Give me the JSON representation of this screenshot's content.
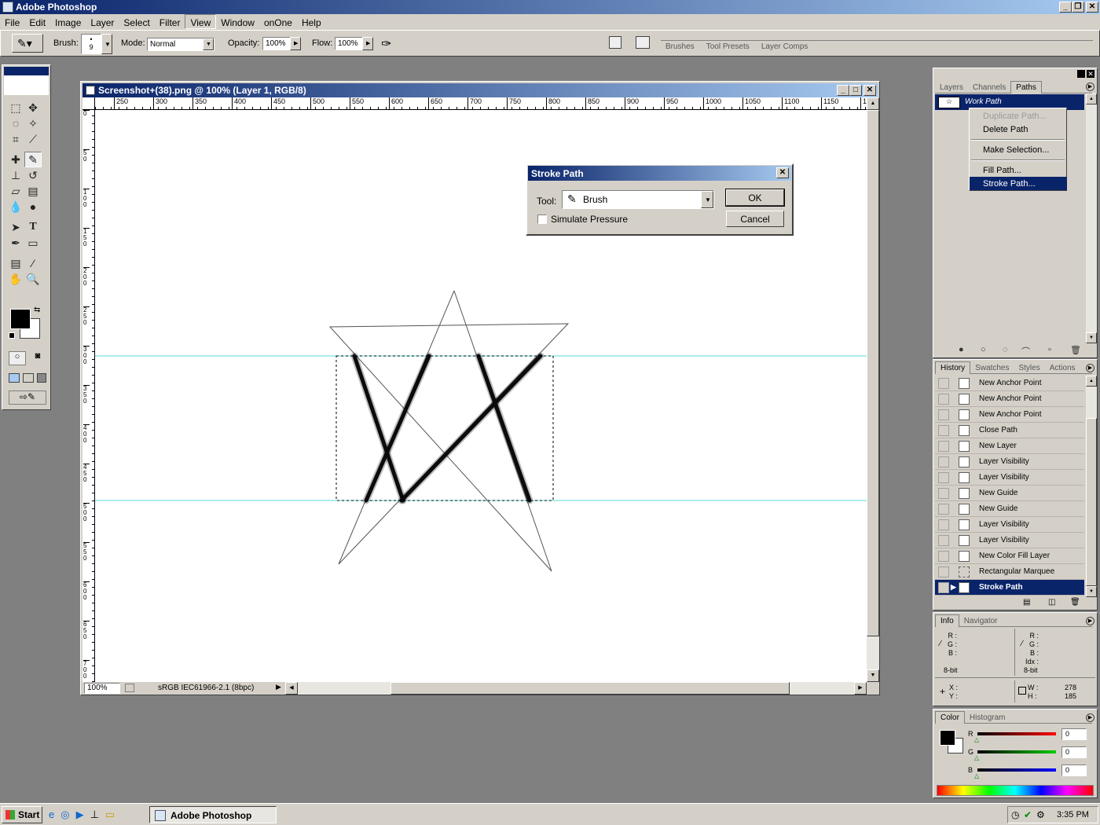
{
  "app": {
    "title": "Adobe Photoshop"
  },
  "menu": [
    "File",
    "Edit",
    "Image",
    "Layer",
    "Select",
    "Filter",
    "View",
    "Window",
    "onOne",
    "Help"
  ],
  "options": {
    "brush_label": "Brush:",
    "brush_size": "9",
    "mode_label": "Mode:",
    "mode_value": "Normal",
    "opacity_label": "Opacity:",
    "opacity_value": "100%",
    "flow_label": "Flow:",
    "flow_value": "100%",
    "well_tabs": [
      "Brushes",
      "Tool Presets",
      "Layer Comps"
    ]
  },
  "document": {
    "title": "Screenshot+(38).png @ 100% (Layer 1, RGB/8)",
    "zoom": "100%",
    "profile": "sRGB IEC61966-2.1 (8bpc)",
    "ruler_h": [
      "250",
      "300",
      "350",
      "400",
      "450",
      "500",
      "550",
      "600",
      "650",
      "700",
      "750",
      "800",
      "850",
      "900",
      "950",
      "1000",
      "1050",
      "1100",
      "1150",
      "12"
    ],
    "ruler_v": [
      "0",
      "5 0",
      "1 0 0",
      "1 5 0",
      "2 0 0",
      "2 5 0",
      "3 0 0",
      "3 5 0",
      "4 0 0",
      "4 5 0",
      "5 0 0",
      "5 5 0",
      "6 0 0",
      "6 5 0",
      "7 0 0"
    ]
  },
  "dialog": {
    "title": "Stroke Path",
    "tool_label": "Tool:",
    "tool_value": "Brush",
    "simulate_label": "Simulate Pressure",
    "simulate_checked": false,
    "ok": "OK",
    "cancel": "Cancel"
  },
  "paths_panel": {
    "tabs": [
      "Layers",
      "Channels",
      "Paths"
    ],
    "work_path": "Work Path",
    "context_menu": [
      {
        "label": "Duplicate Path...",
        "disabled": true
      },
      {
        "label": "Delete Path",
        "disabled": false
      },
      {
        "label": "Make Selection...",
        "disabled": false
      },
      {
        "label": "Fill Path...",
        "disabled": false
      },
      {
        "label": "Stroke Path...",
        "disabled": false,
        "selected": true
      }
    ]
  },
  "history_panel": {
    "tabs": [
      "History",
      "Swatches",
      "Styles",
      "Actions"
    ],
    "items": [
      "New Anchor Point",
      "New Anchor Point",
      "New Anchor Point",
      "Close Path",
      "New Layer",
      "Layer Visibility",
      "Layer Visibility",
      "New Guide",
      "New Guide",
      "Layer Visibility",
      "Layer Visibility",
      "New Color Fill Layer",
      "Rectangular Marquee",
      "Stroke Path"
    ]
  },
  "info_panel": {
    "tabs": [
      "Info",
      "Navigator"
    ],
    "left": {
      "r": "R :",
      "g": "G :",
      "b": "B :",
      "bit": "8-bit"
    },
    "right": {
      "r": "R :",
      "g": "G :",
      "b": "B :",
      "idx": "Idx :",
      "bit": "8-bit"
    },
    "xy": {
      "x": "X :",
      "y": "Y :"
    },
    "wh": {
      "w": "W :",
      "h": "H :",
      "w_val": "278",
      "h_val": "185"
    }
  },
  "color_panel": {
    "tabs": [
      "Color",
      "Histogram"
    ],
    "r_label": "R",
    "g_label": "G",
    "b_label": "B",
    "r": "0",
    "g": "0",
    "b": "0"
  },
  "taskbar": {
    "start": "Start",
    "task": "Adobe Photoshop",
    "clock": "3:35 PM"
  }
}
